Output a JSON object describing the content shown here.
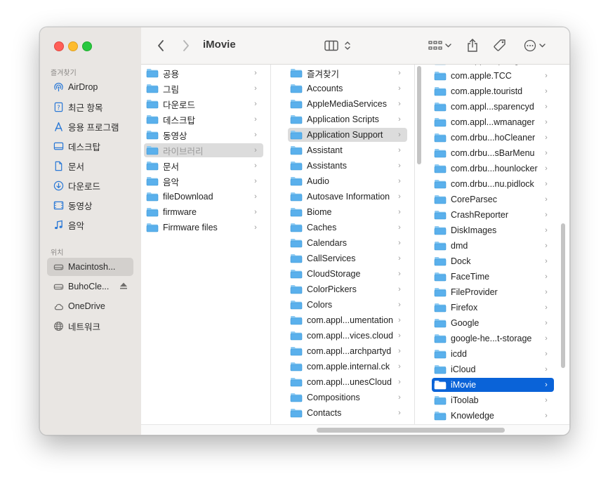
{
  "window": {
    "title": "iMovie"
  },
  "sidebar": {
    "favorites_header": "즐겨찾기",
    "favorites": [
      {
        "label": "AirDrop",
        "icon": "airdrop-icon"
      },
      {
        "label": "최근 항목",
        "icon": "recents-icon"
      },
      {
        "label": "응용 프로그램",
        "icon": "applications-icon"
      },
      {
        "label": "데스크탑",
        "icon": "desktop-icon"
      },
      {
        "label": "문서",
        "icon": "document-icon"
      },
      {
        "label": "다운로드",
        "icon": "downloads-icon"
      },
      {
        "label": "동영상",
        "icon": "movies-icon"
      },
      {
        "label": "음악",
        "icon": "music-icon"
      }
    ],
    "locations_header": "위치",
    "locations": [
      {
        "label": "Macintosh...",
        "icon": "disk-icon",
        "selected": true
      },
      {
        "label": "BuhoCle...",
        "icon": "disk-icon",
        "eject": true
      },
      {
        "label": "OneDrive",
        "icon": "cloud-icon"
      },
      {
        "label": "네트워크",
        "icon": "network-icon"
      }
    ]
  },
  "toolbar": {
    "back": "back-icon",
    "forward": "forward-icon",
    "view": "columns-view-icon",
    "group": "group-grid-icon",
    "share": "share-icon",
    "tag": "tag-icon",
    "more": "more-icon",
    "search": "search-icon"
  },
  "columns": [
    {
      "items": [
        "공용",
        "그림",
        "다운로드",
        "데스크탑",
        "동영상",
        "라이브러리",
        "문서",
        "음악",
        "fileDownload",
        "firmware",
        "Firmware files"
      ],
      "selected_index": 5,
      "selected_style": "gray"
    },
    {
      "items": [
        "즐겨찾기",
        "Accounts",
        "AppleMediaServices",
        "Application Scripts",
        "Application Support",
        "Assistant",
        "Assistants",
        "Audio",
        "Autosave Information",
        "Biome",
        "Caches",
        "Calendars",
        "CallServices",
        "CloudStorage",
        "ColorPickers",
        "Colors",
        "com.appl...umentation",
        "com.appl...vices.cloud",
        "com.appl...archpartyd",
        "com.apple.internal.ck",
        "com.appl...unesCloud",
        "Compositions",
        "Contacts"
      ],
      "selected_index": 4,
      "selected_style": "light"
    },
    {
      "items": [
        "com.apple.spotlight",
        "com.apple.TCC",
        "com.apple.touristd",
        "com.appl...sparencyd",
        "com.appl...wmanager",
        "com.drbu...hoCleaner",
        "com.drbu...sBarMenu",
        "com.drbu...hounlocker",
        "com.drbu...nu.pidlock",
        "CoreParsec",
        "CrashReporter",
        "DiskImages",
        "dmd",
        "Dock",
        "FaceTime",
        "FileProvider",
        "Firefox",
        "Google",
        "google-he...t-storage",
        "icdd",
        "iCloud",
        "iMovie",
        "iToolab",
        "Knowledge"
      ],
      "selected_index": 21,
      "selected_style": "blue"
    }
  ],
  "colors": {
    "accent": "#0a63d8",
    "folder": "#5ab0ec",
    "sidebar_bg": "#e9e6e3"
  }
}
